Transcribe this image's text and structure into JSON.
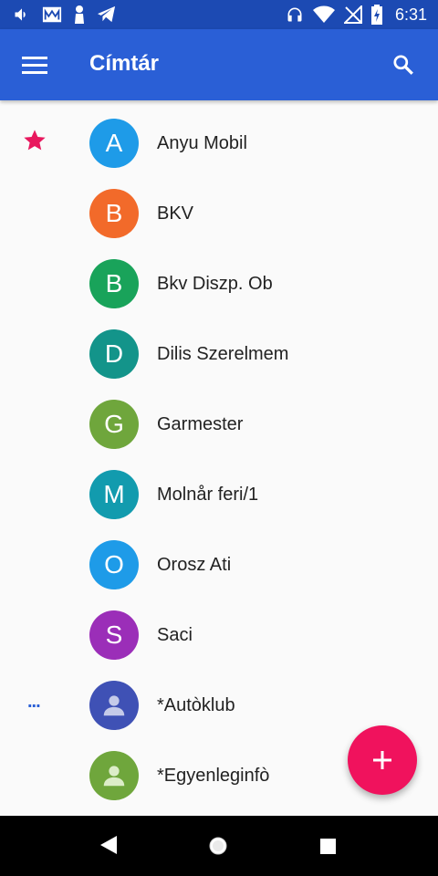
{
  "status_bar": {
    "time": "6:31",
    "left_icons": [
      "volume-icon",
      "email-icon",
      "tie-icon",
      "telegram-icon"
    ],
    "right_icons": [
      "headphones-icon",
      "wifi-icon",
      "no-signal-icon",
      "battery-icon"
    ]
  },
  "app_bar": {
    "title": "Címtár",
    "menu_icon": "hamburger-menu-icon",
    "search_icon": "search-icon"
  },
  "contacts": [
    {
      "letter": "A",
      "name": "Anyu Mobil",
      "color": "#1e9be8",
      "starred": true
    },
    {
      "letter": "B",
      "name": "BKV",
      "color": "#f26a2a"
    },
    {
      "letter": "B",
      "name": "Bkv Diszp. Ob",
      "color": "#19a35a"
    },
    {
      "letter": "D",
      "name": "Dilis Szerelmem",
      "color": "#13948a"
    },
    {
      "letter": "G",
      "name": "Garmester",
      "color": "#6fa63c"
    },
    {
      "letter": "M",
      "name": "Molnår feri/1",
      "color": "#129bae"
    },
    {
      "letter": "O",
      "name": "Orosz Ati",
      "color": "#1e9be8"
    },
    {
      "letter": "S",
      "name": "Saci",
      "color": "#9b2eb8"
    },
    {
      "letter": "",
      "name": "*Autòklub",
      "color": "#3f51b5",
      "person_icon": true,
      "dots": "..."
    },
    {
      "letter": "",
      "name": "*Egyenleginfò",
      "color": "#6fa63c",
      "person_icon": true
    }
  ],
  "fab": {
    "icon": "plus-icon",
    "color": "#f0125d"
  },
  "nav_bar": {
    "icons": [
      "back-icon",
      "home-icon",
      "recent-apps-icon"
    ]
  }
}
